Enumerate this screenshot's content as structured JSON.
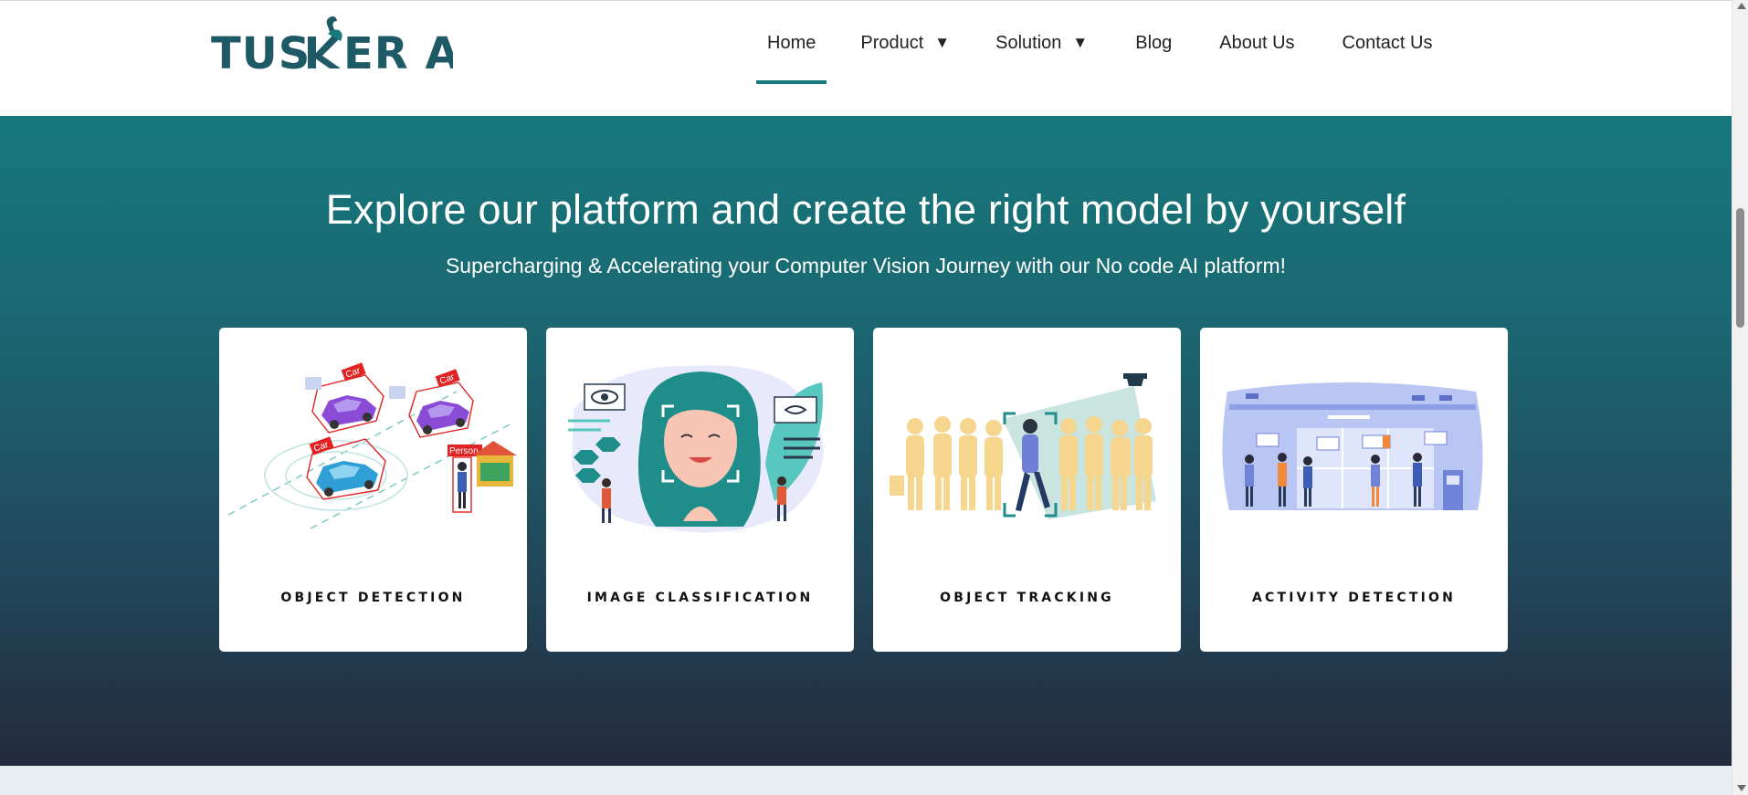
{
  "brand": {
    "name": "TUSKER AI",
    "color": "#1e5a66",
    "accent": "#177a7d"
  },
  "nav": {
    "items": [
      {
        "label": "Home",
        "active": true,
        "has_dropdown": false
      },
      {
        "label": "Product",
        "active": false,
        "has_dropdown": true
      },
      {
        "label": "Solution",
        "active": false,
        "has_dropdown": true
      },
      {
        "label": "Blog",
        "active": false,
        "has_dropdown": false
      },
      {
        "label": "About Us",
        "active": false,
        "has_dropdown": false
      },
      {
        "label": "Contact Us",
        "active": false,
        "has_dropdown": false
      }
    ],
    "dropdown_glyph": "▼"
  },
  "hero": {
    "title": "Explore our platform and create the right model by yourself",
    "subtitle": "Supercharging & Accelerating your Computer Vision Journey with our No code AI platform!",
    "gradient": [
      "#16777b",
      "#232a3d"
    ]
  },
  "cards": [
    {
      "label": "OBJECT DETECTION",
      "icon": "object-detection-illustration"
    },
    {
      "label": "IMAGE CLASSIFICATION",
      "icon": "image-classification-illustration"
    },
    {
      "label": "OBJECT TRACKING",
      "icon": "object-tracking-illustration"
    },
    {
      "label": "ACTIVITY DETECTION",
      "icon": "activity-detection-illustration"
    }
  ],
  "illustration_labels": {
    "car": "Car",
    "person": "Person"
  }
}
